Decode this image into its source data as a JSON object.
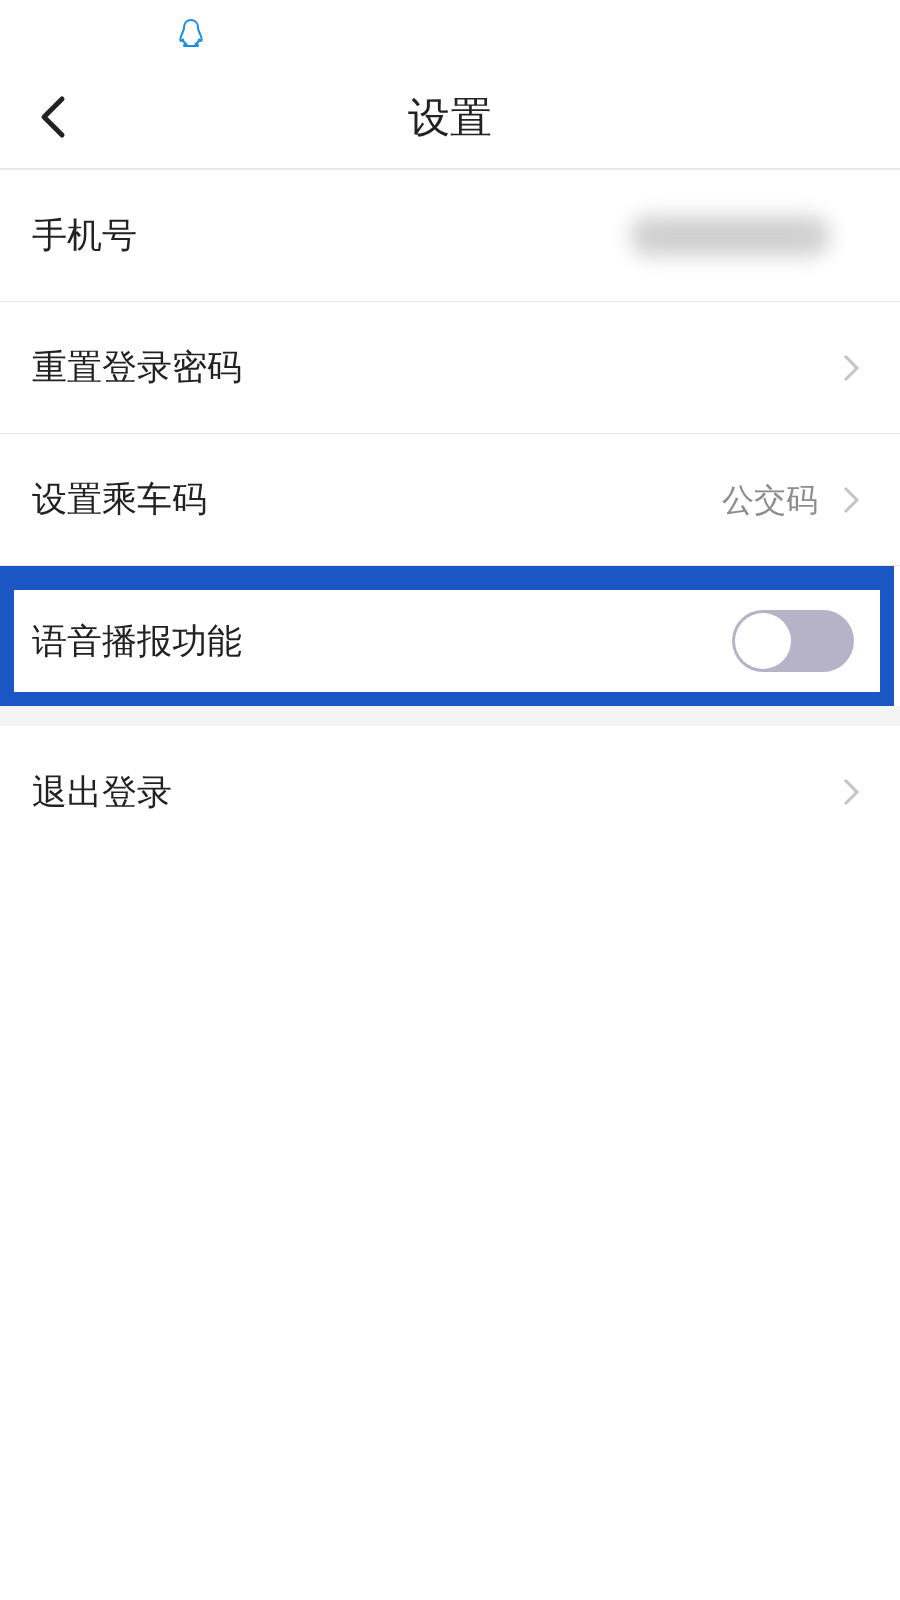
{
  "status_bar": {
    "notifications": [
      {
        "kind": "qq"
      }
    ]
  },
  "header": {
    "title": "设置"
  },
  "sections": [
    {
      "rows": [
        {
          "kind": "masked",
          "label": "手机号"
        },
        {
          "kind": "link",
          "label": "重置登录密码"
        },
        {
          "kind": "link",
          "label": "设置乘车码",
          "value": "公交码"
        },
        {
          "kind": "toggle",
          "label": "语音播报功能",
          "on": false,
          "highlighted": true
        }
      ]
    },
    {
      "rows": [
        {
          "kind": "link",
          "label": "退出登录"
        }
      ]
    }
  ]
}
